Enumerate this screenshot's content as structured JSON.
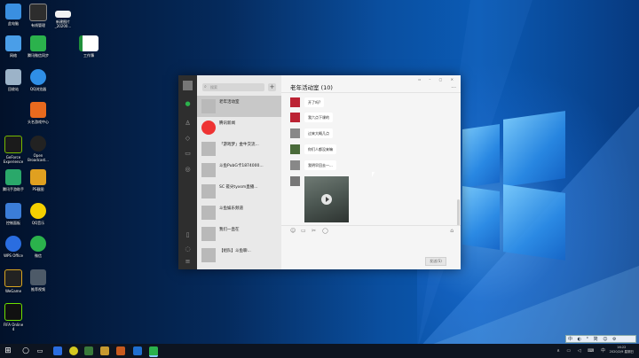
{
  "desktop": {
    "icons": [
      {
        "label": "此电脑"
      },
      {
        "label": "有线管理"
      },
      {
        "label": "新建图片\n_20200..."
      },
      {
        "label": "网络"
      },
      {
        "label": "腾讯微信同步"
      },
      {
        "label": "工作簿"
      },
      {
        "label": "回收站"
      },
      {
        "label": "QQ浏览器"
      },
      {
        "label": "头名游戏中心"
      },
      {
        "label": "GeForce\nExperience"
      },
      {
        "label": "Open\nBroadcast..."
      },
      {
        "label": "腾讯手游助手"
      },
      {
        "label": "PS截图"
      },
      {
        "label": "控制面板"
      },
      {
        "label": "QQ音乐"
      },
      {
        "label": "WPS Office"
      },
      {
        "label": "微信"
      },
      {
        "label": "WeGame"
      },
      {
        "label": "推荐视频"
      },
      {
        "label": "FIFA Online\n4"
      }
    ]
  },
  "wechat": {
    "search_placeholder": "搜索",
    "chat_title": "老年活动室 (10)",
    "conversations": [
      {
        "name": "老年活动室",
        "preview": "",
        "time": ""
      },
      {
        "name": "腾讯新闻",
        "preview": "",
        "time": ""
      },
      {
        "name": "「游戏梦」金牛交流...",
        "preview": "",
        "time": ""
      },
      {
        "name": "斗鱼PubG卡1874000...",
        "preview": "",
        "time": ""
      },
      {
        "name": "SC 搓尖tyxsm直播...",
        "preview": "",
        "time": ""
      },
      {
        "name": "斗鱼娱乐频道",
        "preview": "",
        "time": ""
      },
      {
        "name": "我们一直在",
        "preview": "",
        "time": ""
      },
      {
        "name": "【组队】斗鱼聊...",
        "preview": "",
        "time": ""
      }
    ],
    "messages": [
      {
        "text": "开了吗?"
      },
      {
        "text": "我六点下课的"
      },
      {
        "text": "过来大概几点"
      },
      {
        "text": "你们人都没来嘛"
      },
      {
        "text": "我明早回去一..."
      }
    ],
    "send_label": "发送(S)",
    "toolbar_icons": [
      "smile-icon",
      "folder-icon",
      "scissors-icon",
      "chat-icon"
    ]
  },
  "taskbar": {
    "clock_time": "16:22",
    "clock_date": "2020/2/9 星期日"
  },
  "ime_bar": "中 ◐ ° 简 ☺ ⚙"
}
